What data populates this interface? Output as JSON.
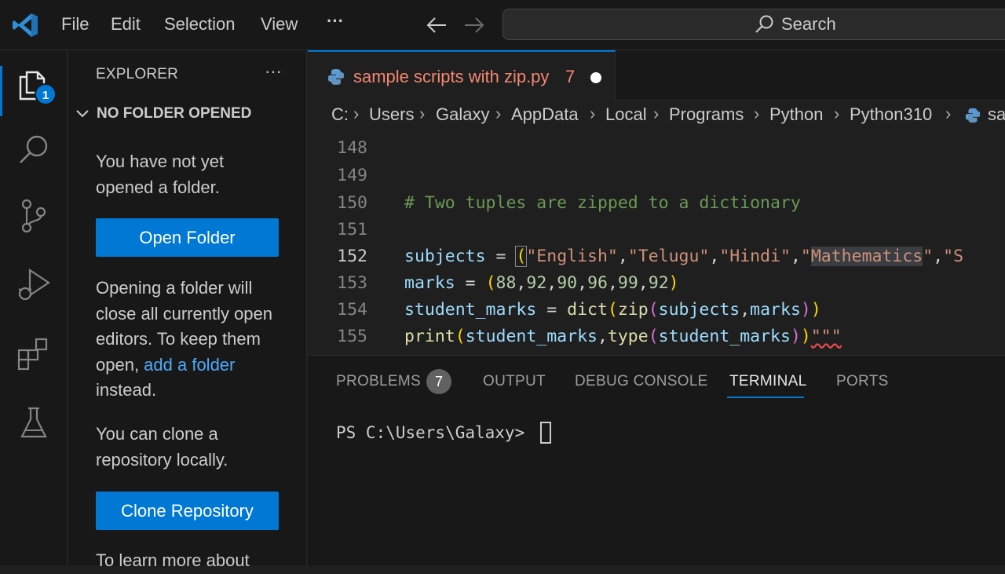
{
  "menu": {
    "file": "File",
    "edit": "Edit",
    "selection": "Selection",
    "view": "View",
    "more": "···"
  },
  "search": {
    "label": "Search"
  },
  "activity": {
    "explorer_badge": "1"
  },
  "sidebar": {
    "title": "EXPLORER",
    "more": "···",
    "section": "NO FOLDER OPENED",
    "text1": "You have not yet opened a folder.",
    "open_folder": "Open Folder",
    "text2_a": "Opening a folder will close all currently open editors. To keep them open, ",
    "text2_link": "add a folder",
    "text2_b": " instead.",
    "text3": "You can clone a repository locally.",
    "clone_repo": "Clone Repository",
    "text4": "To learn more about"
  },
  "tab": {
    "label": "sample scripts with zip.py",
    "count": "7"
  },
  "breadcrumb": {
    "items": [
      "C:",
      "Users",
      "Galaxy",
      "AppData",
      "Local",
      "Programs",
      "Python",
      "Python310",
      "sa"
    ]
  },
  "editor": {
    "line_numbers": [
      "148",
      "149",
      "150",
      "151",
      "152",
      "153",
      "154",
      "155"
    ],
    "comment": "# Two tuples are zipped to a dictionary",
    "subjects_var": "subjects",
    "eq": " = ",
    "open_paren": "(",
    "str1": "\"English\"",
    "str2": "\"Telugu\"",
    "str3": "\"Hindi\"",
    "str4_q": "\"",
    "str4_word": "Mathematics",
    "str5": "\"S",
    "comma": ",",
    "marks_var": "marks",
    "nums": [
      "88",
      "92",
      "90",
      "96",
      "99",
      "92"
    ],
    "close_paren": ")",
    "student_marks_var": "student_marks",
    "dict_fn": "dict",
    "zip_fn": "zip",
    "print_fn": "print",
    "type_fn": "type",
    "triple_quote": "\"\"\""
  },
  "panel": {
    "tabs": [
      "PROBLEMS",
      "OUTPUT",
      "DEBUG CONSOLE",
      "TERMINAL",
      "PORTS"
    ],
    "problems_count": "7",
    "prompt": "PS C:\\Users\\Galaxy> "
  }
}
